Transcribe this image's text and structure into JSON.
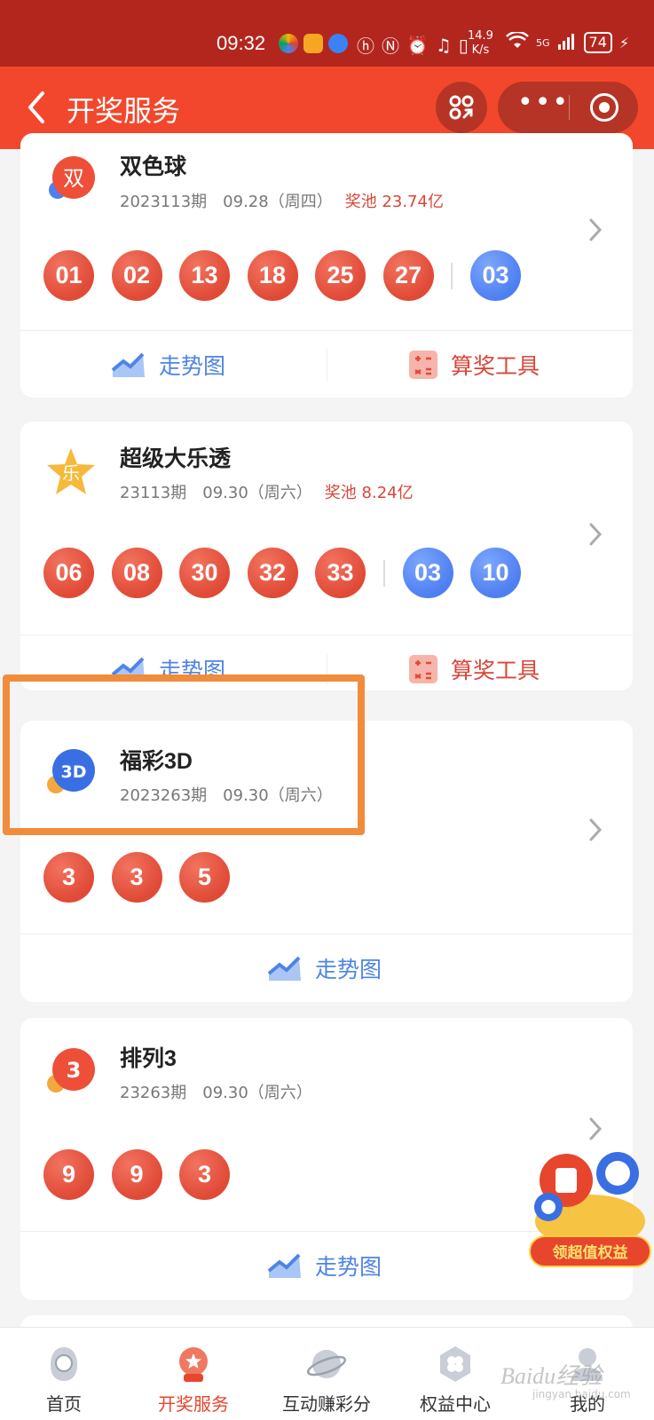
{
  "status": {
    "time": "09:32",
    "speed_top": "14.9",
    "speed_bottom": "K/s",
    "signal": "5G",
    "battery": "74"
  },
  "header": {
    "title": "开奖服务"
  },
  "lotteries": [
    {
      "name": "双色球",
      "issue": "2023113期",
      "date": "09.28（周四）",
      "pool": "奖池 23.74亿",
      "icon_glyph": "双",
      "red_balls": [
        "01",
        "02",
        "13",
        "18",
        "25",
        "27"
      ],
      "blue_balls": [
        "03"
      ],
      "trend_label": "走势图",
      "tool_label": "算奖工具"
    },
    {
      "name": "超级大乐透",
      "issue": "23113期",
      "date": "09.30（周六）",
      "pool": "奖池 8.24亿",
      "icon_glyph": "乐",
      "red_balls": [
        "06",
        "08",
        "30",
        "32",
        "33"
      ],
      "blue_balls": [
        "03",
        "10"
      ],
      "trend_label": "走势图",
      "tool_label": "算奖工具"
    },
    {
      "name": "福彩3D",
      "issue": "2023263期",
      "date": "09.30（周六）",
      "icon_glyph": "3D",
      "red_balls": [
        "3",
        "3",
        "5"
      ],
      "trend_label": "走势图"
    },
    {
      "name": "排列3",
      "issue": "23263期",
      "date": "09.30（周六）",
      "icon_glyph": "3",
      "red_balls": [
        "9",
        "9",
        "3"
      ],
      "trend_label": "走势图"
    }
  ],
  "promo": {
    "label": "领超值权益"
  },
  "nav": [
    {
      "label": "首页",
      "icon": "home-mascot-icon"
    },
    {
      "label": "开奖服务",
      "icon": "lottery-machine-icon",
      "active": true
    },
    {
      "label": "互动赚彩分",
      "icon": "planet-icon"
    },
    {
      "label": "权益中心",
      "icon": "clover-icon"
    },
    {
      "label": "我的",
      "icon": "profile-icon"
    }
  ],
  "watermark": {
    "text": "Baidu经验",
    "sub": "jingyan.baidu.com"
  },
  "colors": {
    "status_bar": "#b3261e",
    "title_bar": "#f2472c",
    "red_ball": "#e04a36",
    "blue_ball": "#4e7ff0",
    "highlight": "#f08c3c"
  }
}
